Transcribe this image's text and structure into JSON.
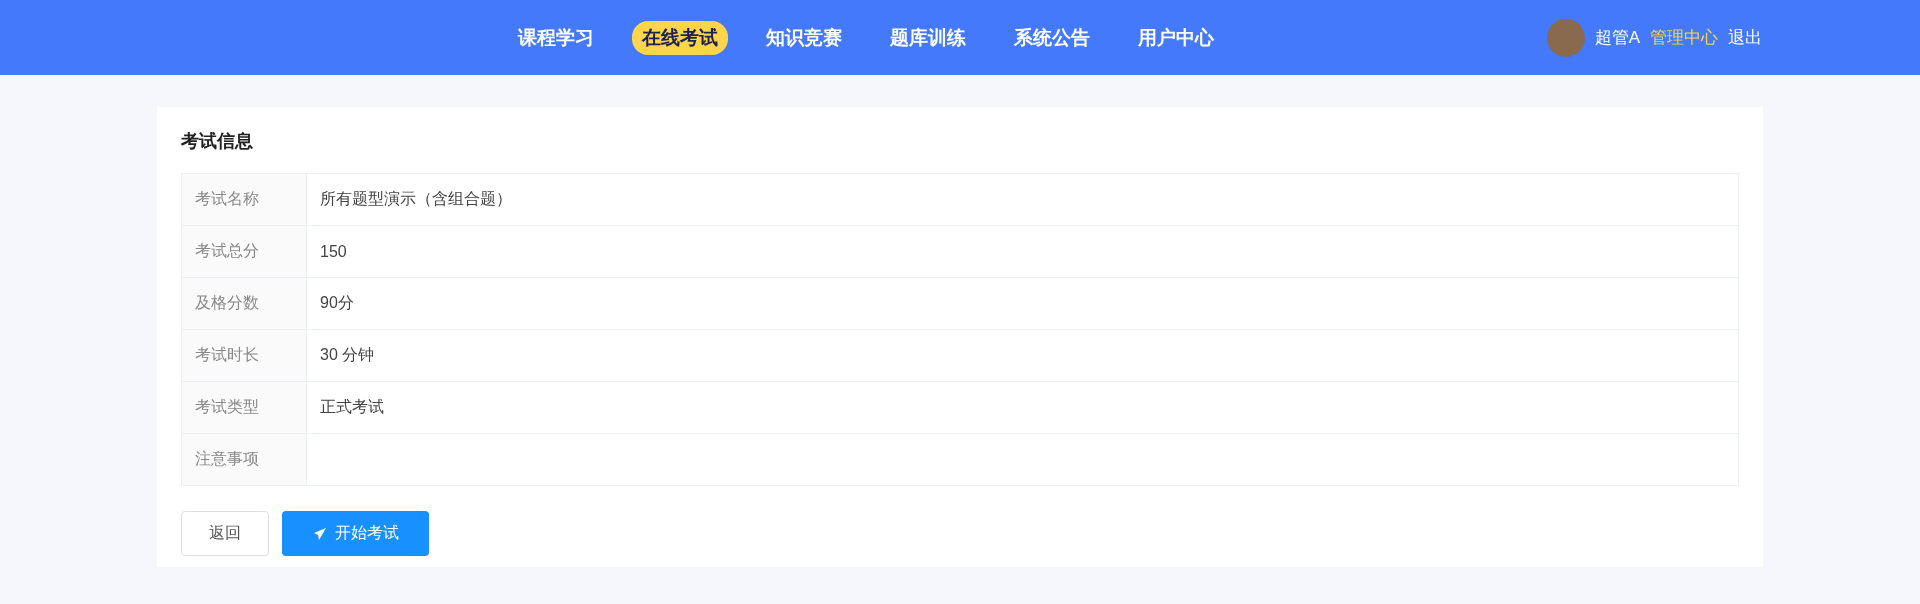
{
  "nav": {
    "items": [
      {
        "label": "课程学习",
        "selected": false
      },
      {
        "label": "在线考试",
        "selected": true
      },
      {
        "label": "知识竞赛",
        "selected": false
      },
      {
        "label": "题库训练",
        "selected": false
      },
      {
        "label": "系统公告",
        "selected": false
      },
      {
        "label": "用户中心",
        "selected": false
      }
    ],
    "user": {
      "name": "超管A",
      "admin_link": "管理中心",
      "logout": "退出"
    }
  },
  "exam_info": {
    "title": "考试信息",
    "rows": [
      {
        "label": "考试名称",
        "value": "所有题型演示（含组合题）"
      },
      {
        "label": "考试总分",
        "value": "150"
      },
      {
        "label": "及格分数",
        "value": "90分"
      },
      {
        "label": "考试时长",
        "value": "30 分钟"
      },
      {
        "label": "考试类型",
        "value": "正式考试"
      },
      {
        "label": "注意事项"
      }
    ]
  },
  "buttons": {
    "back": "返回",
    "start": "开始考试"
  }
}
